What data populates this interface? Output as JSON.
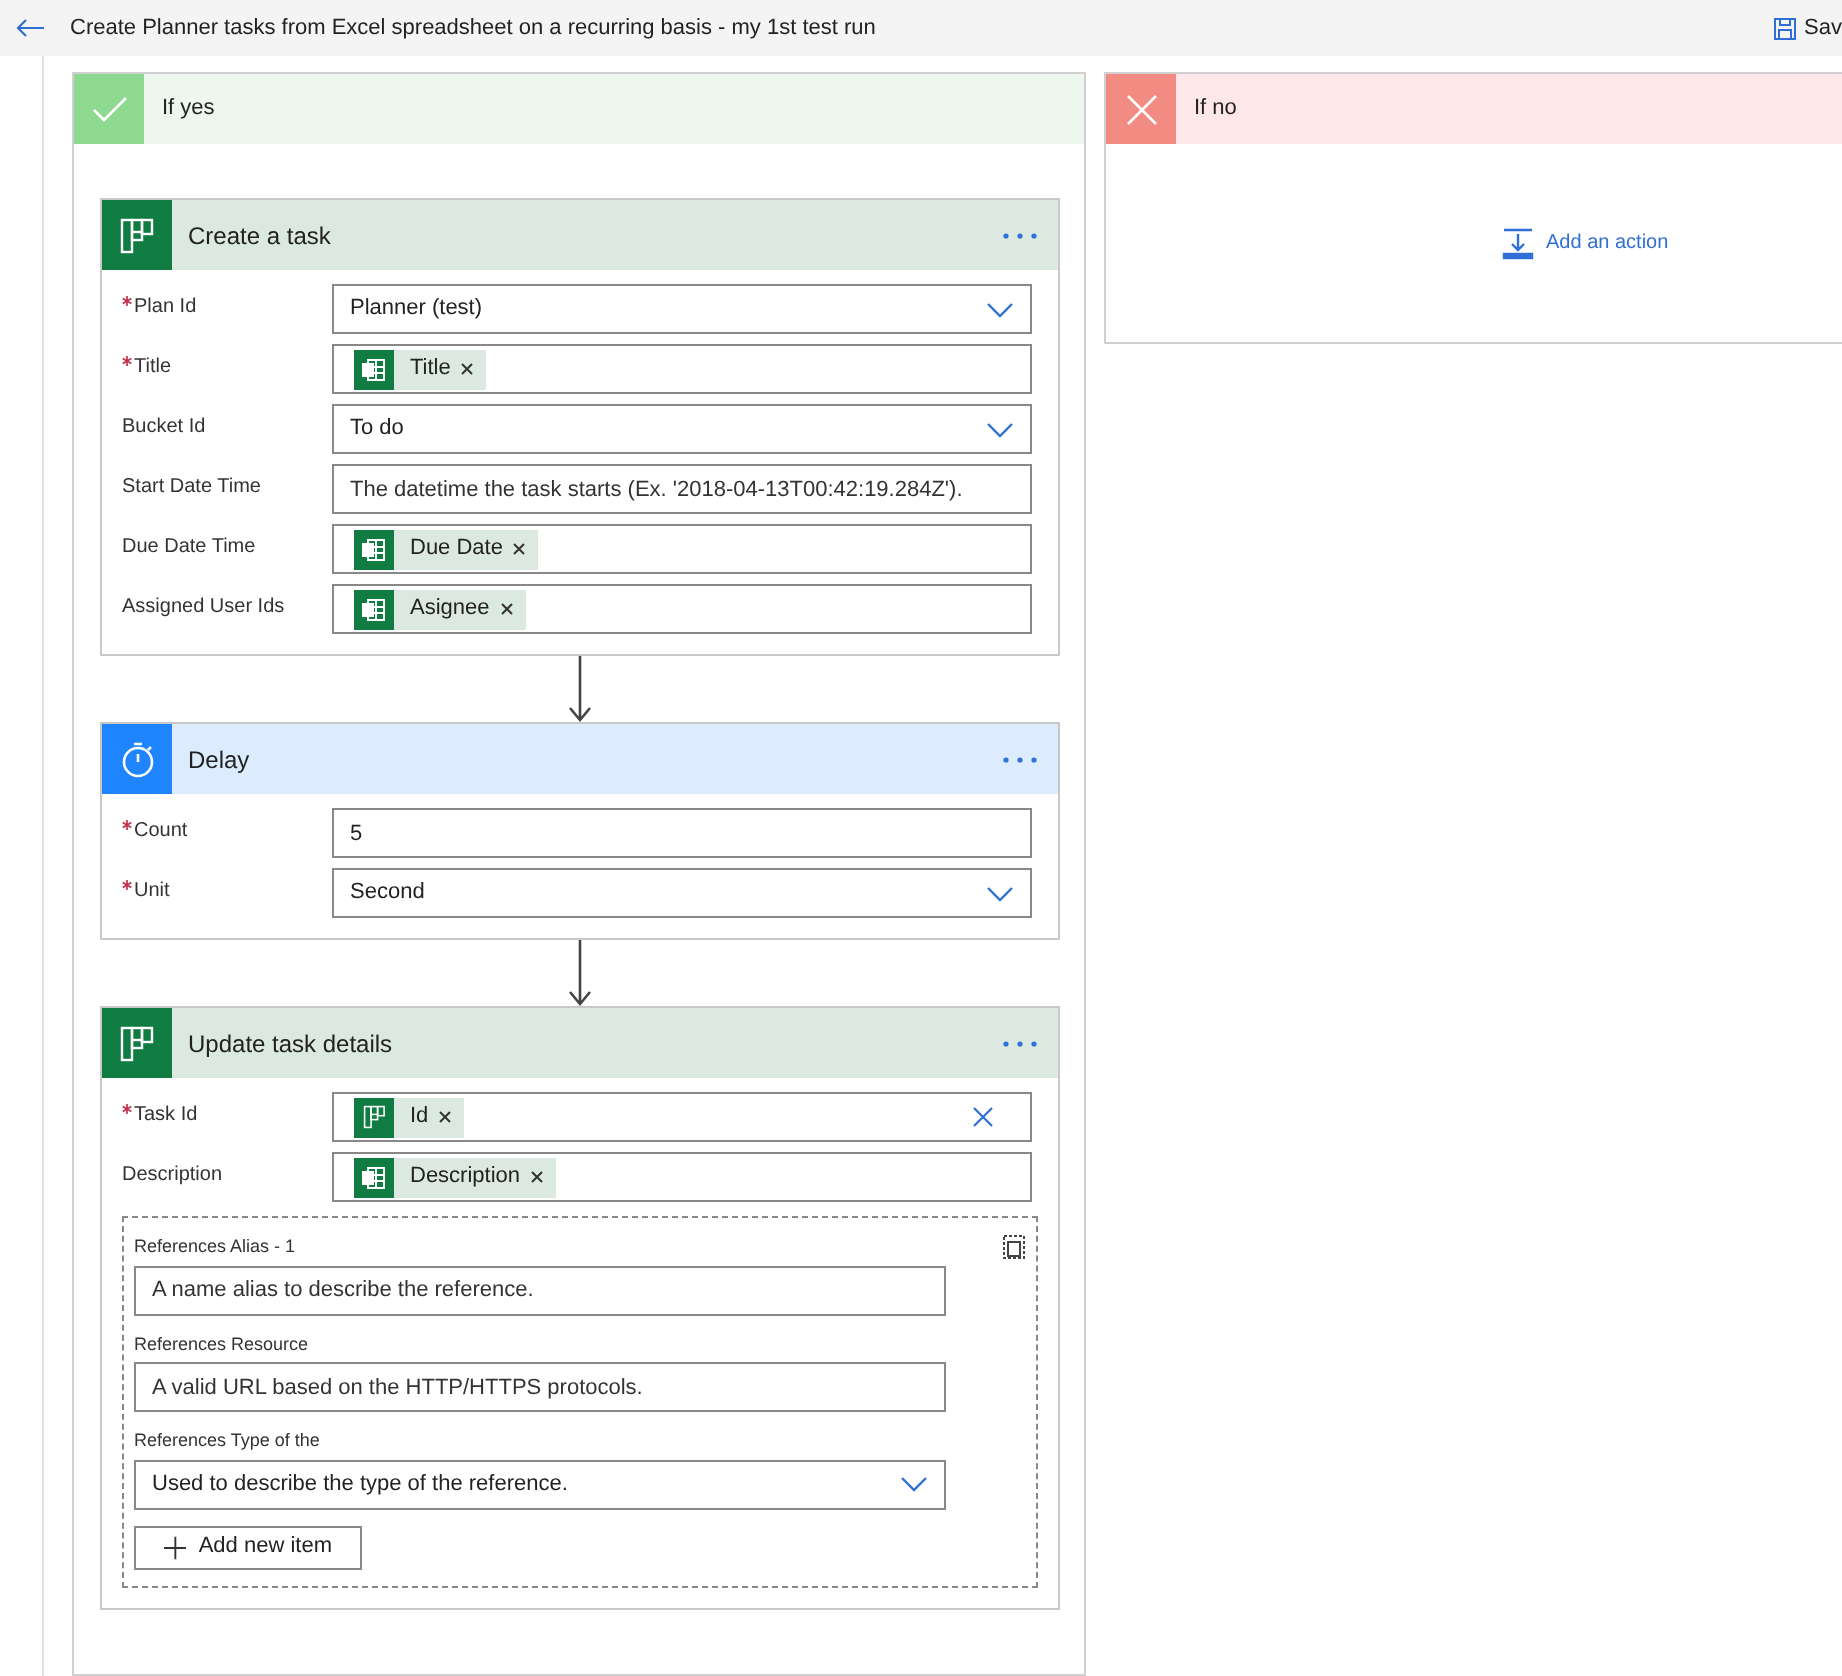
{
  "header": {
    "title": "Create Planner tasks from Excel spreadsheet on a recurring basis - my 1st test run",
    "save": "Sav"
  },
  "branches": [
    {
      "kind": "yes",
      "title": "If yes"
    },
    {
      "kind": "no",
      "title": "If no",
      "add_action": "Add an action"
    }
  ],
  "cards": [
    {
      "kind": "planner",
      "title": "Create a task",
      "fields": [
        {
          "label": "Plan Id",
          "required": true,
          "kind": "dropdown",
          "value": "Planner (test)"
        },
        {
          "label": "Title",
          "required": true,
          "kind": "tokens",
          "tokens": [
            {
              "text": "Title",
              "kind": "excel"
            }
          ]
        },
        {
          "label": "Bucket Id",
          "required": false,
          "kind": "dropdown",
          "value": "To do"
        },
        {
          "label": "Start Date Time",
          "required": false,
          "kind": "text",
          "placeholder": "The datetime the task starts (Ex. '2018-04-13T00:42:19.284Z')."
        },
        {
          "label": "Due Date Time",
          "required": false,
          "kind": "tokens",
          "tokens": [
            {
              "text": "Due Date",
              "kind": "excel"
            }
          ]
        },
        {
          "label": "Assigned User Ids",
          "required": false,
          "kind": "tokens",
          "tokens": [
            {
              "text": "Asignee",
              "kind": "excel"
            }
          ]
        }
      ]
    },
    {
      "kind": "delay",
      "title": "Delay",
      "fields": [
        {
          "label": "Count",
          "required": true,
          "kind": "text",
          "value": "5"
        },
        {
          "label": "Unit",
          "required": true,
          "kind": "dropdown",
          "value": "Second"
        }
      ]
    },
    {
      "kind": "planner",
      "title": "Update task details",
      "fields": [
        {
          "label": "Task Id",
          "required": true,
          "kind": "tokens",
          "clearable": true,
          "tokens": [
            {
              "text": "Id",
              "kind": "planner"
            }
          ]
        },
        {
          "label": "Description",
          "required": false,
          "kind": "tokens",
          "tokens": [
            {
              "text": "Description",
              "kind": "excel"
            }
          ]
        }
      ],
      "references": {
        "fields": [
          {
            "label": "References Alias - 1",
            "kind": "text",
            "placeholder": "A name alias to describe the reference."
          },
          {
            "label": "References Resource",
            "kind": "text",
            "placeholder": "A valid URL based on the HTTP/HTTPS protocols."
          },
          {
            "label": "References Type of the",
            "kind": "dropdown",
            "placeholder": "Used to describe the type of the reference."
          }
        ],
        "add_button": "Add new item"
      }
    }
  ]
}
